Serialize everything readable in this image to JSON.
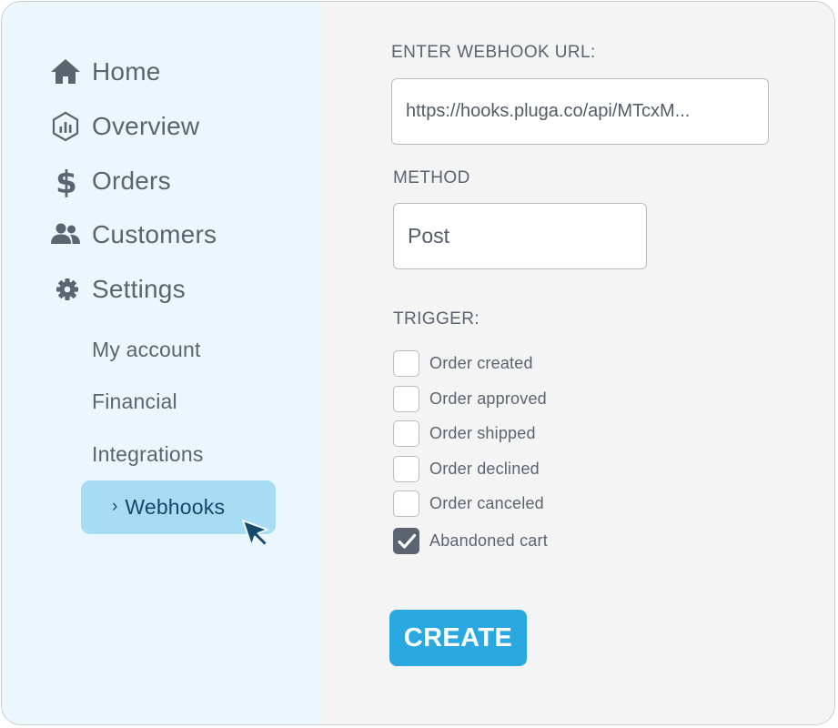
{
  "sidebar": {
    "items": [
      {
        "label": "Home",
        "icon": "home-icon"
      },
      {
        "label": "Overview",
        "icon": "overview-chart-icon"
      },
      {
        "label": "Orders",
        "icon": "dollar-icon"
      },
      {
        "label": "Customers",
        "icon": "users-icon"
      },
      {
        "label": "Settings",
        "icon": "gear-icon"
      }
    ],
    "settings_sub": [
      {
        "label": "My account"
      },
      {
        "label": "Financial"
      },
      {
        "label": "Integrations"
      }
    ],
    "active_sub": {
      "label": "Webhooks",
      "chevron": "›"
    }
  },
  "form": {
    "url_label": "ENTER WEBHOOK URL:",
    "url_value": "https://hooks.pluga.co/api/MTcxM...",
    "method_label": "METHOD",
    "method_value": "Post",
    "trigger_label": "TRIGGER:",
    "triggers": [
      {
        "label": "Order created",
        "checked": false
      },
      {
        "label": "Order approved",
        "checked": false
      },
      {
        "label": "Order shipped",
        "checked": false
      },
      {
        "label": "Order declined",
        "checked": false
      },
      {
        "label": "Order canceled",
        "checked": false
      },
      {
        "label": "Abandoned cart",
        "checked": true
      }
    ],
    "create_label": "CREATE"
  },
  "colors": {
    "sidebar_bg": "#ebf6fd",
    "main_bg": "#f4f4f4",
    "text": "#5b6470",
    "active_bg": "#a6ddf2",
    "active_text": "#17466a",
    "accent": "#29a9e0",
    "cursor": "#14496b"
  }
}
